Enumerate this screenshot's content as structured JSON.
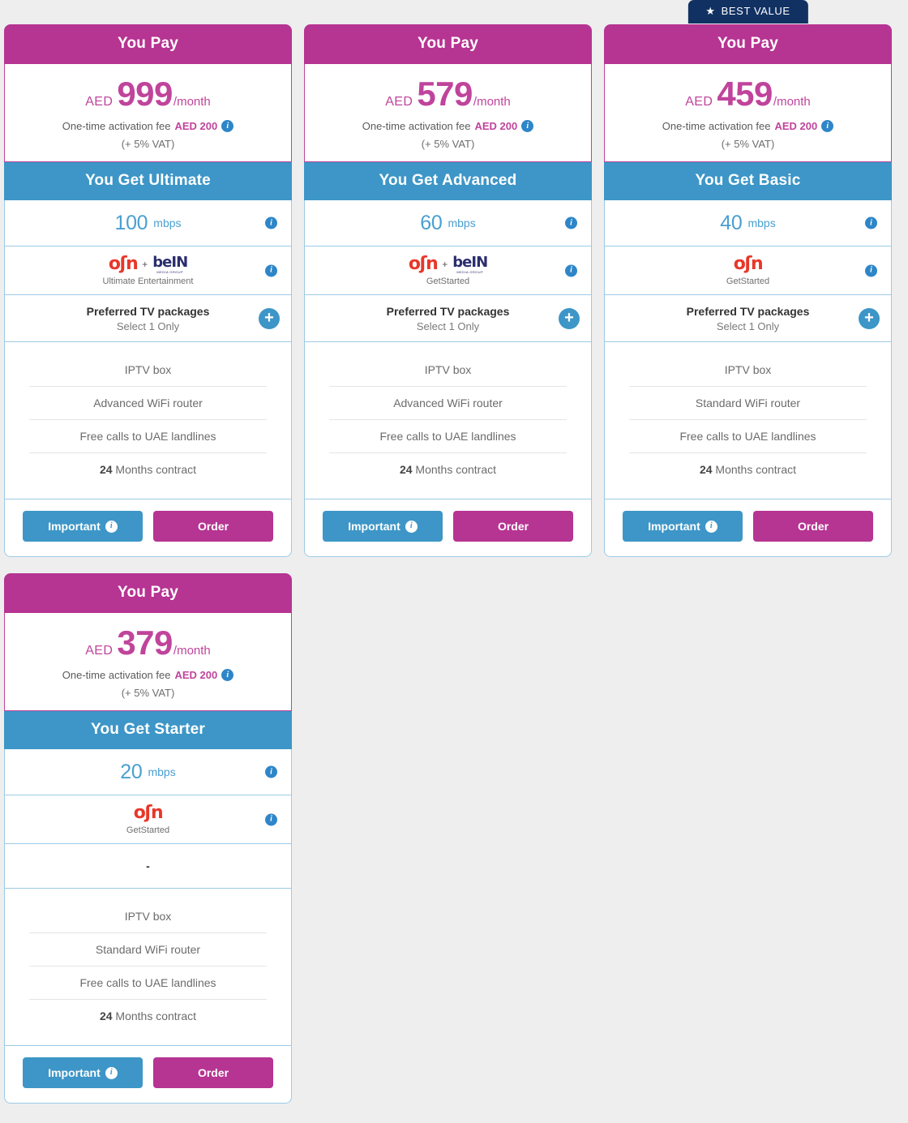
{
  "badge": {
    "label": "BEST VALUE",
    "icon": "star-icon",
    "color": "#123163"
  },
  "labels": {
    "pay_header": "You Pay",
    "currency": "AED",
    "per_month": "/month",
    "activation_prefix": "One-time activation fee",
    "activation_amount": "AED 200",
    "vat": "(+ 5% VAT)",
    "speed_unit": "mbps",
    "tv_title": "Preferred TV packages",
    "tv_sub": "Select 1 Only",
    "plus": "+",
    "dash": "-",
    "important_button": "Important",
    "order_button": "Order",
    "info_glyph": "i"
  },
  "colors": {
    "magenta": "#b63492",
    "magenta_border": "#c0449b",
    "blue": "#3d96c7",
    "blue_border": "#9dcbe6",
    "navy": "#123163",
    "osn_red": "#e8372a",
    "bein_navy": "#2b2d6e",
    "page_bg": "#eeeeee"
  },
  "cards": [
    {
      "best_value": false,
      "price": "999",
      "plan_header": "You Get Ultimate",
      "speed": "100",
      "has_bein": true,
      "logo_caption": "Ultimate Entertainment",
      "tv_row_type": "packages",
      "features": [
        {
          "bold": "",
          "text": "IPTV box"
        },
        {
          "bold": "",
          "text": "Advanced WiFi router"
        },
        {
          "bold": "",
          "text": "Free calls to UAE landlines"
        },
        {
          "bold": "24",
          "text": " Months contract"
        }
      ]
    },
    {
      "best_value": false,
      "price": "579",
      "plan_header": "You Get Advanced",
      "speed": "60",
      "has_bein": true,
      "logo_caption": "GetStarted",
      "tv_row_type": "packages",
      "features": [
        {
          "bold": "",
          "text": "IPTV box"
        },
        {
          "bold": "",
          "text": "Advanced WiFi router"
        },
        {
          "bold": "",
          "text": "Free calls to UAE landlines"
        },
        {
          "bold": "24",
          "text": " Months contract"
        }
      ]
    },
    {
      "best_value": true,
      "price": "459",
      "plan_header": "You Get Basic",
      "speed": "40",
      "has_bein": false,
      "logo_caption": "GetStarted",
      "tv_row_type": "packages",
      "features": [
        {
          "bold": "",
          "text": "IPTV box"
        },
        {
          "bold": "",
          "text": "Standard WiFi router"
        },
        {
          "bold": "",
          "text": "Free calls to UAE landlines"
        },
        {
          "bold": "24",
          "text": " Months contract"
        }
      ]
    },
    {
      "best_value": false,
      "price": "379",
      "plan_header": "You Get Starter",
      "speed": "20",
      "has_bein": false,
      "logo_caption": "GetStarted",
      "tv_row_type": "dash",
      "features": [
        {
          "bold": "",
          "text": "IPTV box"
        },
        {
          "bold": "",
          "text": "Standard WiFi router"
        },
        {
          "bold": "",
          "text": "Free calls to UAE landlines"
        },
        {
          "bold": "24",
          "text": " Months contract"
        }
      ]
    }
  ],
  "logo_text": {
    "osn": "OSN",
    "osn_glyph": "oʃn",
    "bein": "beIN",
    "bein_sub": "MEDIA GROUP",
    "separator": "+"
  }
}
